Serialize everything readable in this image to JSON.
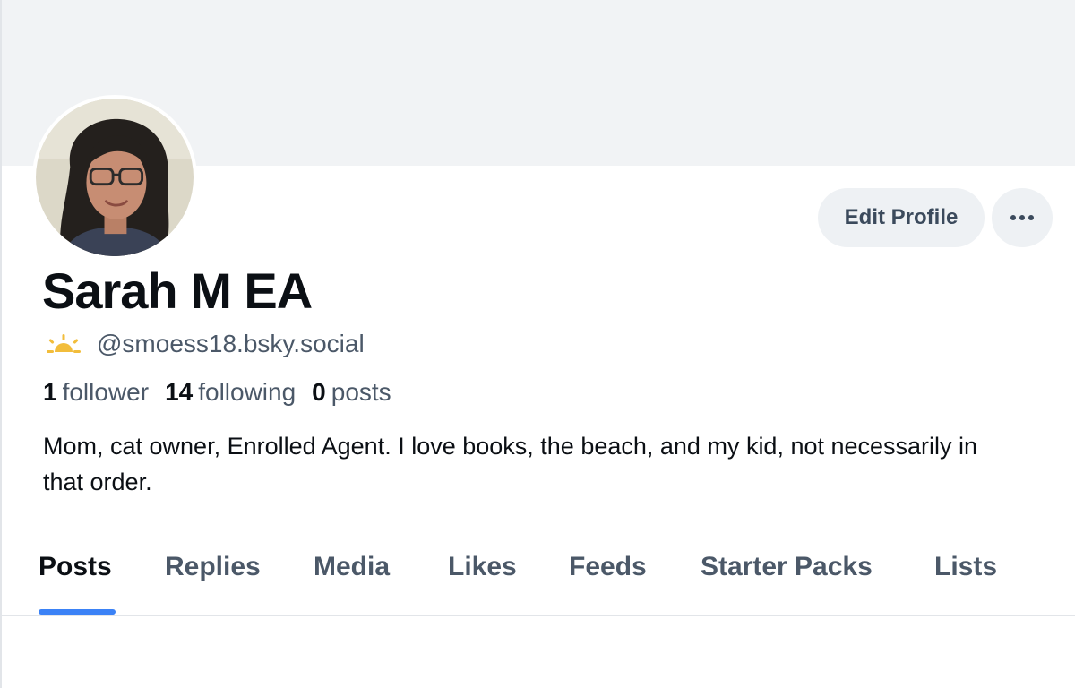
{
  "profile": {
    "display_name": "Sarah M EA",
    "handle": "@smoess18.bsky.social",
    "bio": "Mom, cat owner, Enrolled Agent. I love books, the beach, and my kid, not necessarily in that order.",
    "handle_icon": "sunrise-icon"
  },
  "stats": {
    "followers_count": "1",
    "followers_label": "follower",
    "following_count": "14",
    "following_label": "following",
    "posts_count": "0",
    "posts_label": "posts"
  },
  "actions": {
    "edit_label": "Edit Profile",
    "more_icon": "ellipsis-icon"
  },
  "tabs": [
    {
      "label": "Posts",
      "active": true
    },
    {
      "label": "Replies",
      "active": false
    },
    {
      "label": "Media",
      "active": false
    },
    {
      "label": "Likes",
      "active": false
    },
    {
      "label": "Feeds",
      "active": false
    },
    {
      "label": "Starter Packs",
      "active": false
    },
    {
      "label": "Lists",
      "active": false
    }
  ],
  "colors": {
    "accent": "#3b82f6",
    "banner": "#f1f3f5",
    "button_bg": "#eef1f4",
    "muted_text": "#4b5868",
    "sun": "#f2bd3b"
  }
}
